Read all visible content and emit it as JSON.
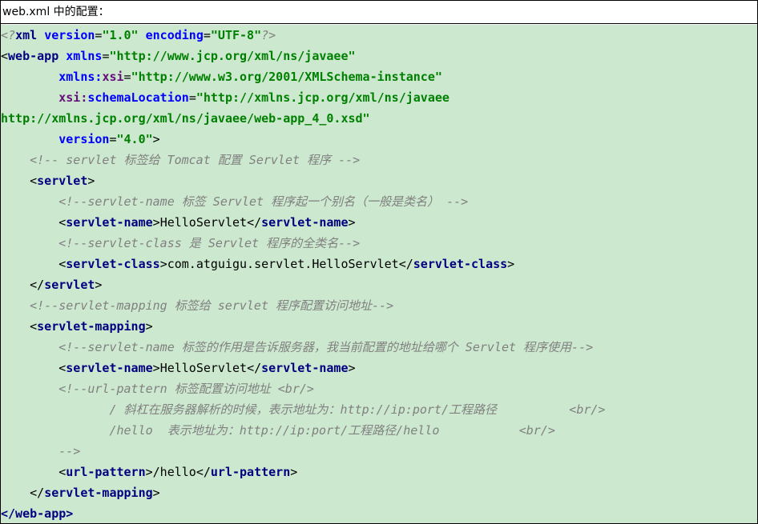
{
  "title": "web.xml 中的配置：",
  "decl": {
    "open": "<?",
    "name": "xml",
    "attr1": "version",
    "val1": "\"1.0\"",
    "attr2": "encoding",
    "val2": "\"UTF-8\"",
    "close": "?>"
  },
  "webapp": {
    "lt": "<",
    "tag": "web-app",
    "xmlns_attr": "xmlns",
    "eq": "=",
    "xmlns_val": "\"http://www.jcp.org/xml/ns/javaee\"",
    "xsi_prefix": "xmlns:",
    "xsi_name": "xsi",
    "xsi_val": "\"http://www.w3.org/2001/XMLSchema-instance\"",
    "schema_prefix": "xsi:",
    "schema_name": "schemaLocation",
    "schema_val1": "\"http://xmlns.jcp.org/xml/ns/javaee",
    "schema_val2": "http://xmlns.jcp.org/xml/ns/javaee/web-app_4_0.xsd\"",
    "version_attr": "version",
    "version_val": "\"4.0\"",
    "gt": ">",
    "end_tag": "</web-app>"
  },
  "comments": {
    "c1": "<!-- servlet 标签给 Tomcat 配置 Servlet 程序 -->",
    "c2": "<!--servlet-name 标签 Servlet 程序起一个别名（一般是类名） -->",
    "c3": "<!--servlet-class 是 Servlet 程序的全类名-->",
    "c4": "<!--servlet-mapping 标签给 servlet 程序配置访问地址-->",
    "c5": "<!--servlet-name 标签的作用是告诉服务器，我当前配置的地址给哪个 Servlet 程序使用-->",
    "c6": "<!--url-pattern 标签配置访问地址 <br/>",
    "c7": "/ 斜杠在服务器解析的时候，表示地址为：http://ip:port/工程路径          <br/>",
    "c8": "/hello  表示地址为：http://ip:port/工程路径/hello           <br/>",
    "c9": "-->"
  },
  "tags": {
    "servlet": "servlet",
    "servlet_name": "servlet-name",
    "servlet_class": "servlet-class",
    "servlet_mapping": "servlet-mapping",
    "url_pattern": "url-pattern"
  },
  "values": {
    "servlet_name": "HelloServlet",
    "servlet_class": "com.atguigu.servlet.HelloServlet",
    "url_pattern": "/hello"
  }
}
